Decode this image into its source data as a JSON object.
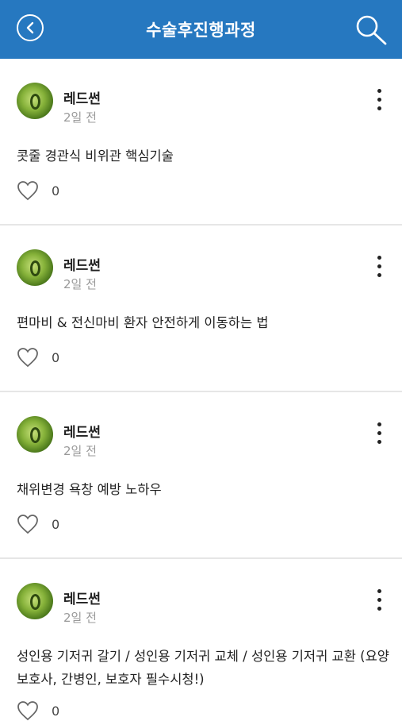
{
  "header": {
    "title": "수술후진행과정",
    "back_icon": "chevron-left-circle-icon",
    "search_icon": "search-icon",
    "background": "#2678c0"
  },
  "posts": [
    {
      "author": "레드썬",
      "time": "2일 전",
      "content": "콧줄 경관식 비위관 핵심기술",
      "likes": "0"
    },
    {
      "author": "레드썬",
      "time": "2일 전",
      "content": "편마비 & 전신마비 환자 안전하게 이동하는 법",
      "likes": "0"
    },
    {
      "author": "레드썬",
      "time": "2일 전",
      "content": "채위변경 욕창 예방 노하우",
      "likes": "0"
    },
    {
      "author": "레드썬",
      "time": "2일 전",
      "content": "성인용 기저귀 갈기 / 성인용 기저귀 교체 / 성인용 기저귀 교환 (요양보호사, 간병인, 보호자 필수시청!)",
      "likes": "0"
    }
  ]
}
